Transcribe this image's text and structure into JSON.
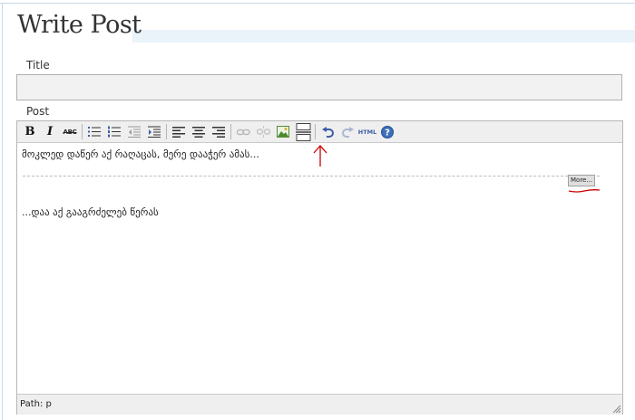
{
  "page": {
    "title": "Write Post"
  },
  "form": {
    "title_label": "Title",
    "title_value": "",
    "post_label": "Post"
  },
  "toolbar": {
    "bold_label": "B",
    "italic_label": "I",
    "strikethrough_label": "ABC",
    "html_label": "HTML",
    "buttons": [
      {
        "name": "bold-button",
        "icon": "bold-icon"
      },
      {
        "name": "italic-button",
        "icon": "italic-icon"
      },
      {
        "name": "strikethrough-button",
        "icon": "strikethrough-icon"
      },
      {
        "name": "bullet-list-button",
        "icon": "bullet-list-icon"
      },
      {
        "name": "numbered-list-button",
        "icon": "numbered-list-icon"
      },
      {
        "name": "outdent-button",
        "icon": "outdent-icon"
      },
      {
        "name": "indent-button",
        "icon": "indent-icon"
      },
      {
        "name": "align-left-button",
        "icon": "align-left-icon"
      },
      {
        "name": "align-center-button",
        "icon": "align-center-icon"
      },
      {
        "name": "align-right-button",
        "icon": "align-right-icon"
      },
      {
        "name": "insert-link-button",
        "icon": "link-icon"
      },
      {
        "name": "unlink-button",
        "icon": "unlink-icon"
      },
      {
        "name": "insert-image-button",
        "icon": "image-icon"
      },
      {
        "name": "insert-more-button",
        "icon": "more-break-icon"
      },
      {
        "name": "undo-button",
        "icon": "undo-icon"
      },
      {
        "name": "redo-button",
        "icon": "redo-icon"
      },
      {
        "name": "html-button",
        "icon": "html-icon"
      },
      {
        "name": "help-button",
        "icon": "help-icon"
      }
    ]
  },
  "editor": {
    "line1": "მოკლედ დაწერ აქ რაღაცას, მერე დააჭერ ამას...",
    "more_tag": "More...",
    "line2": "...დაა აქ გააგრძელებ წერას",
    "annotation_color": "#cc0000"
  },
  "status": {
    "path": "Path: p"
  },
  "colors": {
    "toolbar_bg": "#efefef",
    "title_band": "#eaf3fa",
    "input_bg": "#f2f2f2",
    "icon_blue": "#3c5da6",
    "annotation_red": "#cc0000"
  }
}
